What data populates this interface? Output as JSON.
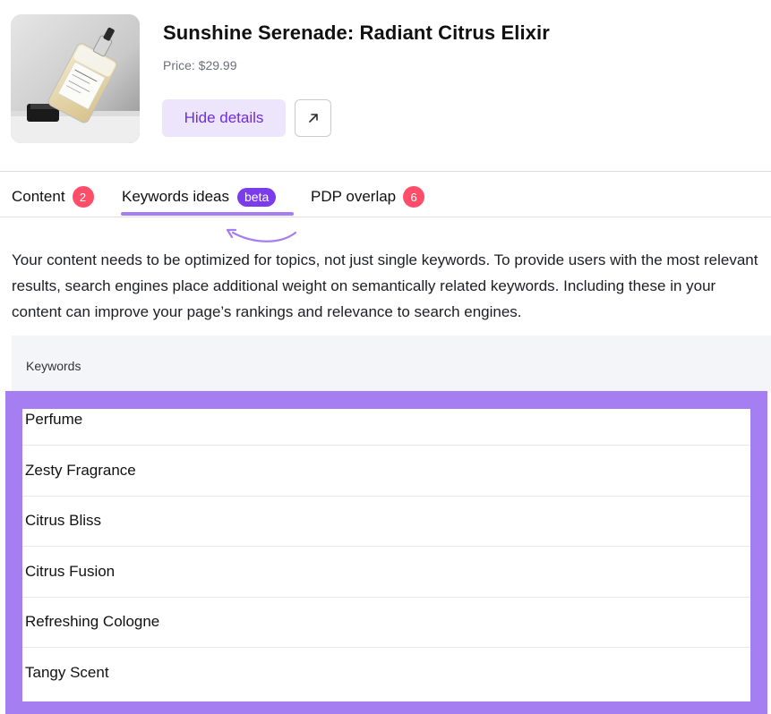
{
  "product": {
    "title": "Sunshine Serenade: Radiant Citrus Elixir",
    "price": "Price: $29.99",
    "image_icon": "perfume-bottle-image",
    "hide_details_label": "Hide details",
    "open_link_icon": "arrow-up-right-icon"
  },
  "tabs": [
    {
      "label": "Content",
      "badge": "2",
      "badge_color": "#ff4d6a"
    },
    {
      "label": "Keywords ideas",
      "badge": "beta",
      "badge_color": "#7c3bed",
      "active": true
    },
    {
      "label": "PDP overlap",
      "badge": "6",
      "badge_color": "#ff4d6a"
    }
  ],
  "description": "Your content needs to be optimized for topics, not just single keywords. To provide users with the most relevant results, search engines place additional weight on semantically related keywords. Including these in your content can improve your page’s rankings and relevance to search engines.",
  "table": {
    "header": "Keywords",
    "rows": [
      "Perfume",
      "Zesty Fragrance",
      "Citrus Bliss",
      "Citrus Fusion",
      "Refreshing Cologne",
      "Tangy Scent"
    ]
  },
  "colors": {
    "accent": "#7c3bed",
    "highlight": "#a57ff2",
    "badge_red": "#ff4d6a",
    "button_bg": "#ece5fb"
  }
}
